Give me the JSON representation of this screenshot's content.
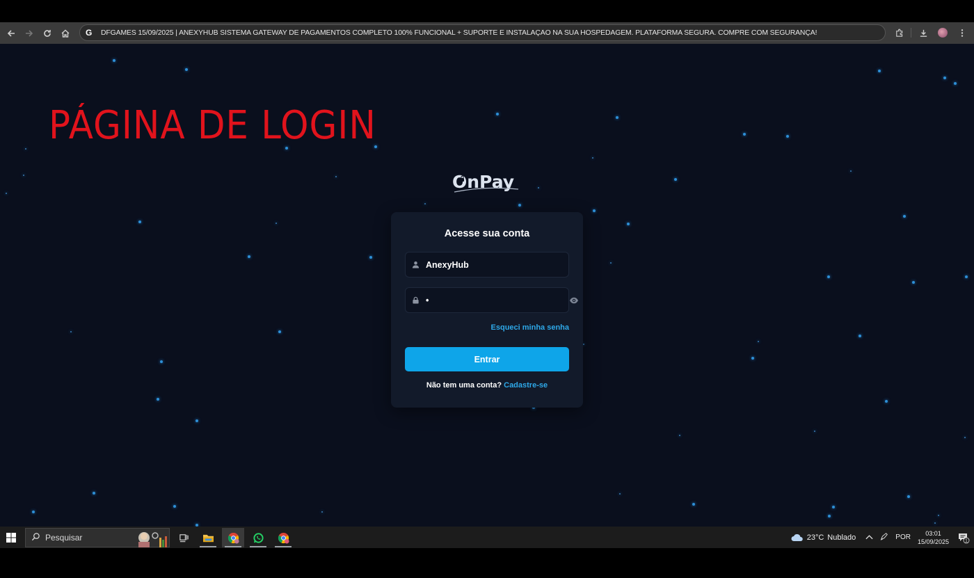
{
  "browser": {
    "url_text": "DFGAMES 15/09/2025 | ANEXYHUB SISTEMA GATEWAY DE PAGAMENTOS COMPLETO 100% FUNCIONAL + SUPORTE E INSTALAÇÃO NA SUA HOSPEDAGEM. PLATAFORMA SEGURA. COMPRE COM SEGURANÇA!"
  },
  "banner": {
    "text": "PÁGINA DE LOGIN"
  },
  "logo": {
    "text": "OnPay"
  },
  "login": {
    "title": "Acesse sua conta",
    "username_value": "AnexyHub",
    "password_value": "•",
    "forgot_label": "Esqueci minha senha",
    "submit_label": "Entrar",
    "signup_prompt": "Não tem uma conta?",
    "signup_link": "Cadastre-se"
  },
  "taskbar": {
    "search_placeholder": "Pesquisar",
    "weather_temp": "23°C",
    "weather_desc": "Nublado",
    "language": "POR",
    "time": "03:01",
    "date": "15/09/2025",
    "notification_count": "1"
  },
  "colors": {
    "page_bg": "#0a0f1d",
    "card_bg": "#121a2a",
    "accent": "#0ea5e9",
    "banner_red": "#e1131c",
    "star": "#2e8fd6"
  }
}
